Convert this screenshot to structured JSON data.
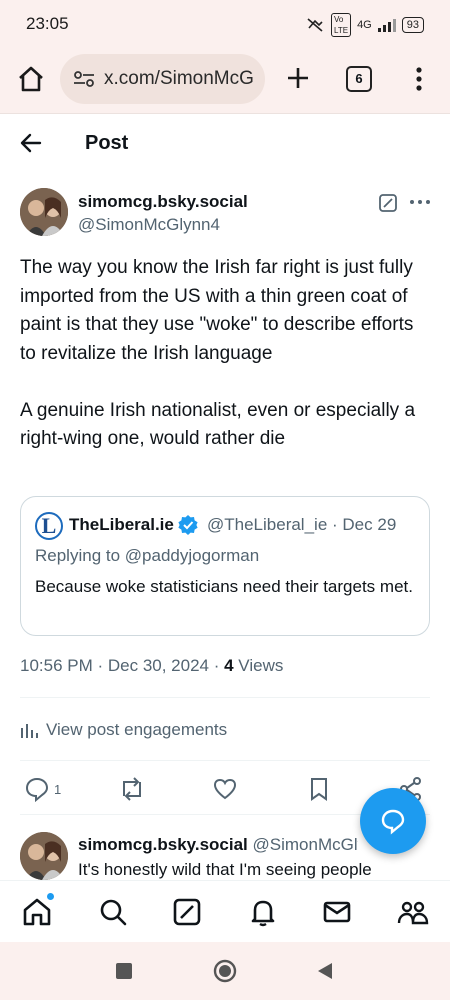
{
  "status_bar": {
    "time": "23:05",
    "network": "4G",
    "battery": "93"
  },
  "browser": {
    "url": "x.com/SimonMcG",
    "tab_count": "6"
  },
  "header": {
    "title": "Post"
  },
  "post": {
    "author_name": "simomcg.bsky.social",
    "author_handle": "@SimonMcGlynn4",
    "paragraphs": [
      "The way you know the Irish far right is just fully imported from the US with a thin green coat of paint is that they use \"woke\" to describe efforts to revitalize the Irish language",
      "A genuine Irish nationalist, even or especially a right-wing one, would rather die"
    ],
    "quote": {
      "avatar_letter": "L",
      "name": "TheLiberal.ie",
      "handle": "@TheLiberal_ie",
      "date": "Dec 29",
      "replying_to": "Replying to @paddyjogorman",
      "text": "Because woke statisticians need their targets met."
    },
    "timestamp": "10:56 PM · Dec 30, 2024 · ",
    "views_count": "4",
    "views_label": " Views",
    "engagements_label": "View post engagements",
    "reply_count": "1"
  },
  "reply": {
    "author_name": "simomcg.bsky.social",
    "author_handle": "@SimonMcGlynn4",
    "text": "It's honestly wild that I'm seeing people"
  },
  "colors": {
    "accent": "#1d9bf0",
    "secondary_text": "#536471",
    "browser_chrome": "#fbf0ee"
  },
  "icons": {
    "nav": [
      "home-icon",
      "search-icon",
      "compose-icon",
      "notifications-icon",
      "messages-icon",
      "communities-icon"
    ],
    "actions": [
      "reply-icon",
      "repost-icon",
      "like-icon",
      "bookmark-icon",
      "share-icon"
    ]
  }
}
